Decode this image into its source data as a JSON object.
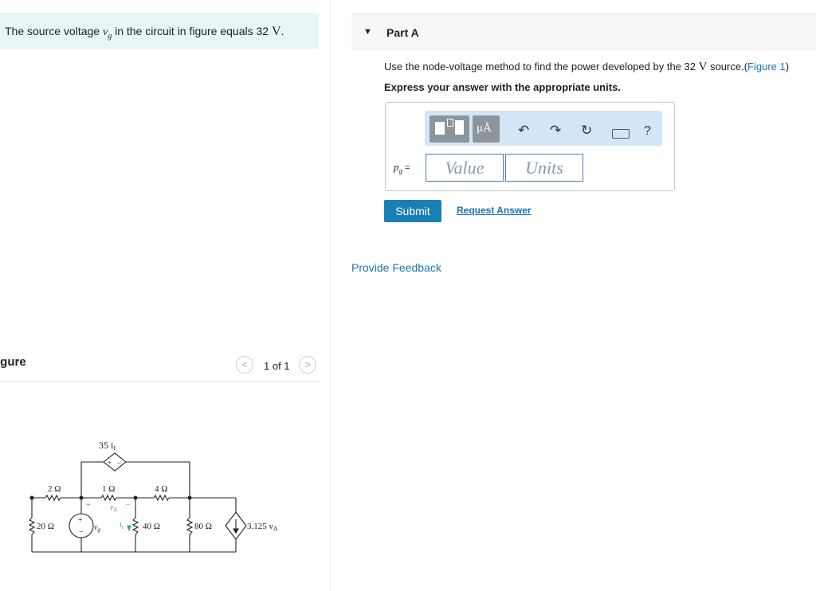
{
  "problem": {
    "pre": "The source voltage ",
    "var": "v",
    "sub": "g",
    "post": " in the circuit in figure equals 32 ",
    "unit": "V",
    "end": "."
  },
  "figure": {
    "title": "igure",
    "pager_prev": "<",
    "pager_text": "1 of 1",
    "pager_next": ">",
    "circuit": {
      "dep_source_label": "35 i",
      "dep_source_sub": "t",
      "dep_plus": "+",
      "dep_minus": "−",
      "r_2": "2 Ω",
      "r_1": "1 Ω",
      "r_4": "4 Ω",
      "r_20": "20 Ω",
      "r_40": "40 Ω",
      "r_80": "80 Ω",
      "vg_label": "v",
      "vg_sub": "g",
      "vg_plus": "+",
      "vg_minus": "−",
      "vdelta_label": "v",
      "vdelta_sub": "Δ",
      "vdelta_plus": "+",
      "vdelta_minus": "−",
      "it_label": "i",
      "it_sub": "t",
      "current_source_label": "3.125 v",
      "current_source_sub": "Δ"
    }
  },
  "part": {
    "title": "Part A",
    "question_pre": "Use the node-voltage method to find the power developed by the 32 ",
    "question_unit": "V",
    "question_post": " source.(",
    "figure_link": "Figure 1",
    "question_close": ")",
    "instruction": "Express your answer with the appropriate units.",
    "answer_label": "p",
    "answer_sub": "g",
    "answer_eq": " =",
    "value_placeholder": "Value",
    "units_placeholder": "Units",
    "toolbar_units_glyph": "μÅ",
    "help_glyph": "?",
    "submit": "Submit",
    "request_answer": "Request Answer",
    "feedback": "Provide Feedback"
  },
  "colors": {
    "accent": "#1a7fb5",
    "link": "#1a73b8",
    "problem_bg": "#e9f6f7",
    "toolbar_bg": "#d3e6f8"
  }
}
